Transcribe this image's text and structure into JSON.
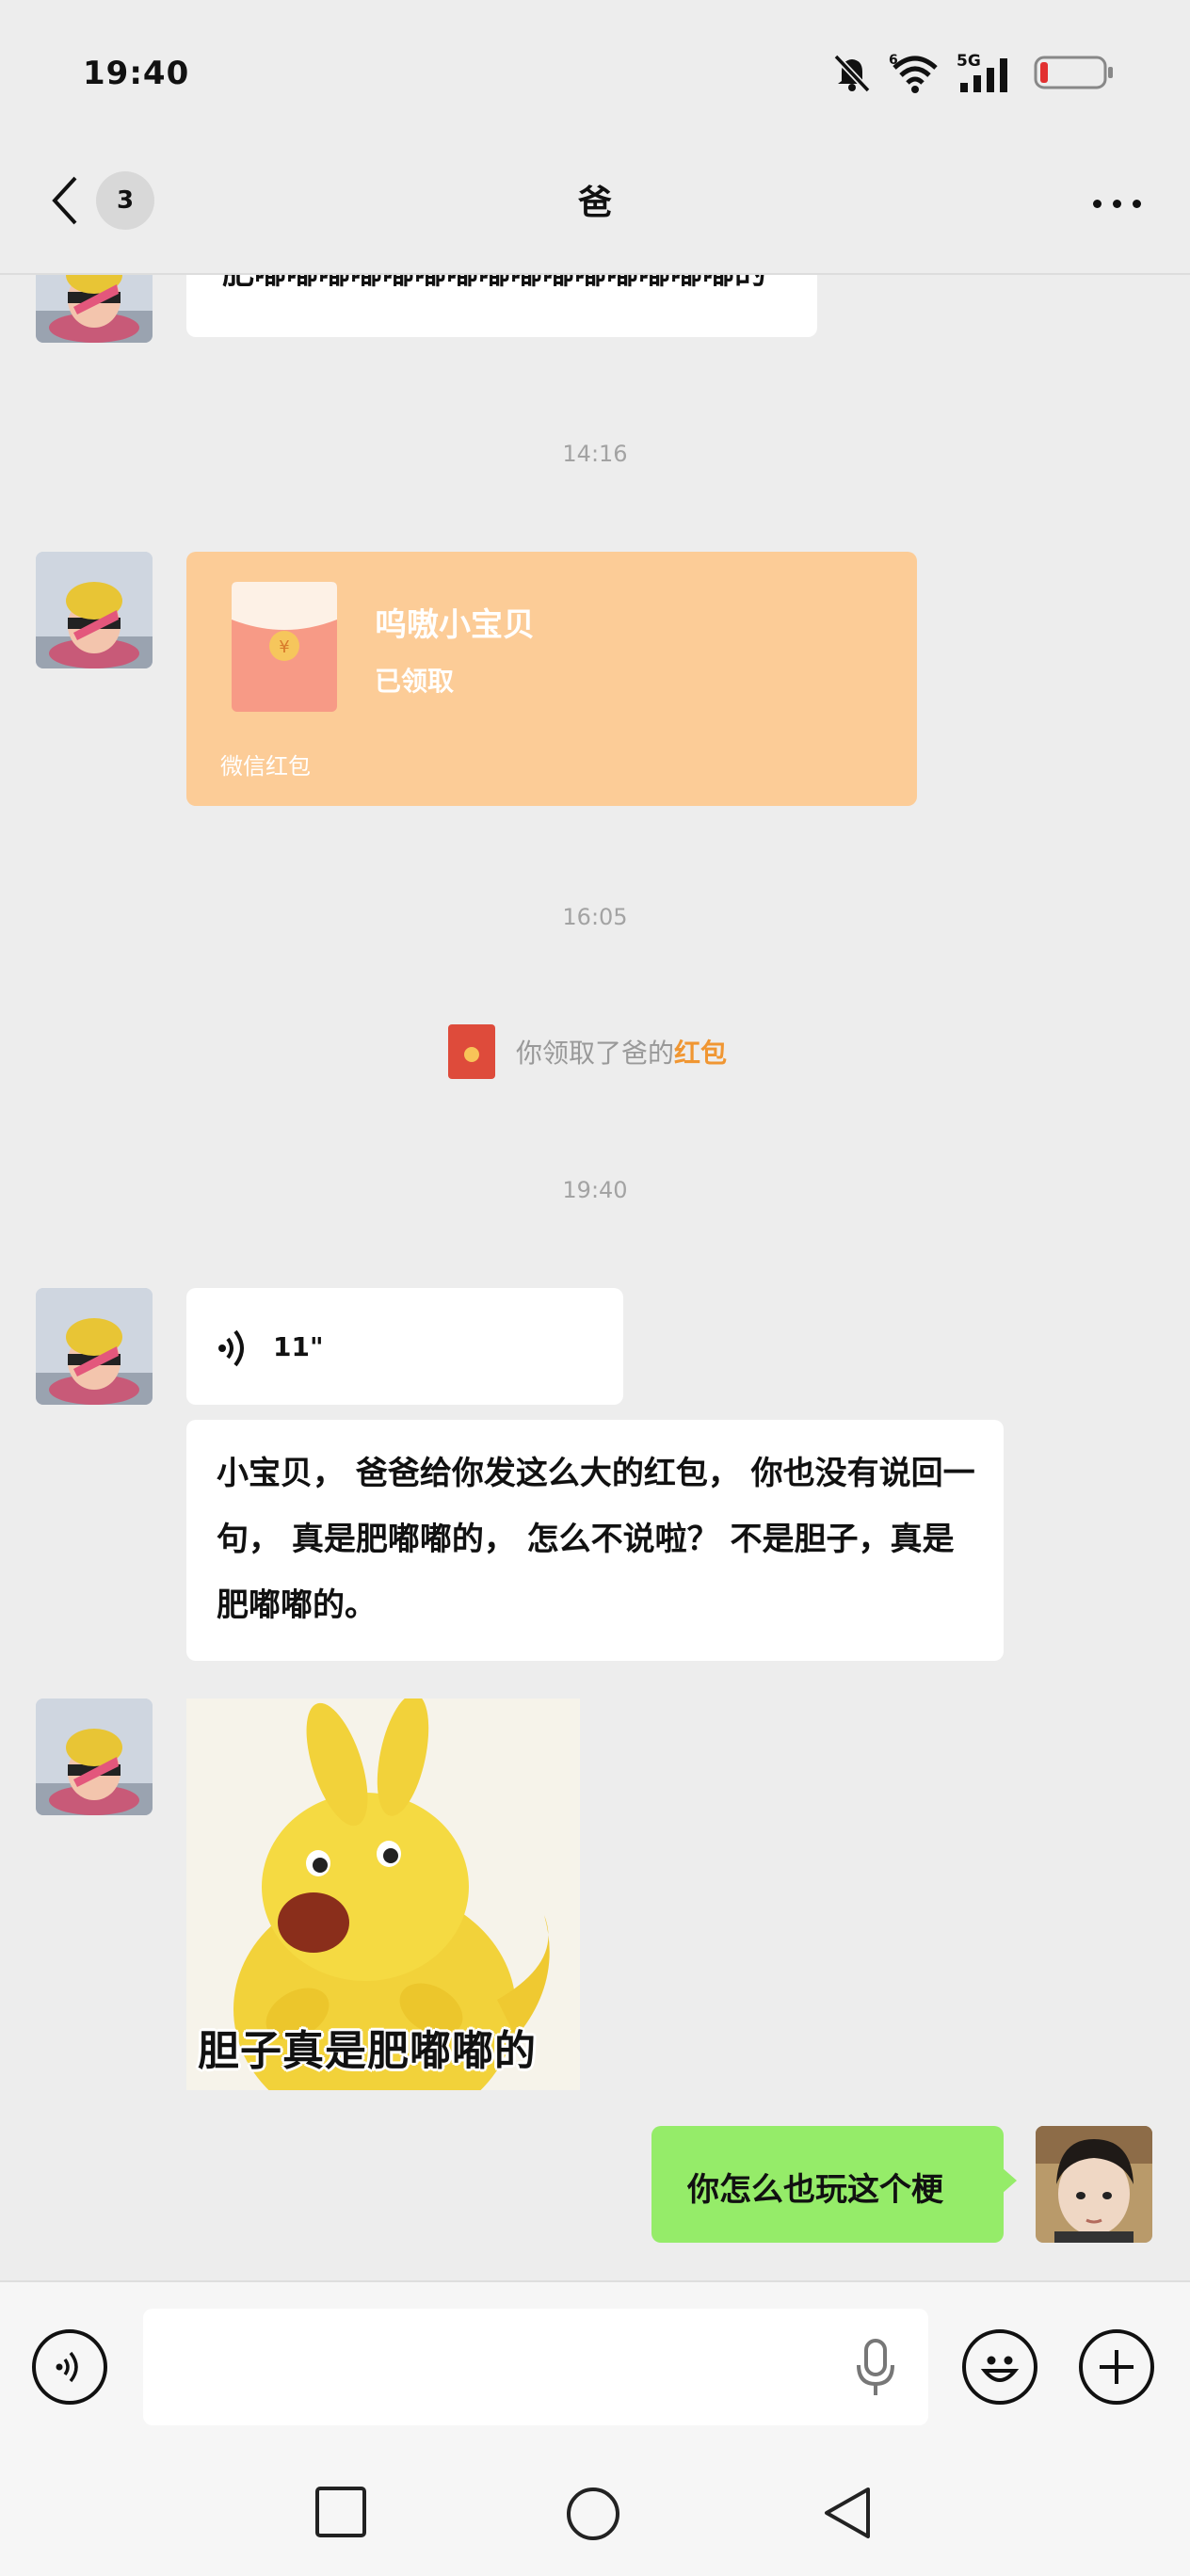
{
  "status_bar": {
    "time": "19:40",
    "signal_label": "5G"
  },
  "nav": {
    "unread_count": "3",
    "title": "爸"
  },
  "messages": {
    "partial_text": "肥嘟嘟嘟嘟嘟嘟嘟嘟嘟嘟嘟嘟嘟嘟嘟的",
    "time_1": "14:16",
    "red_packet": {
      "title": "呜嗷小宝贝",
      "status": "已领取",
      "footer": "微信红包"
    },
    "time_2": "16:05",
    "system_prefix": "你领取了爸的",
    "system_link": "红包",
    "time_3": "19:40",
    "voice_length": "11\"",
    "text_message": "小宝贝， 爸爸给你发这么大的红包， 你也没有说回一句， 真是肥嘟嘟的， 怎么不说啦？ 不是胆子，真是肥嘟嘟的。",
    "sticker_caption": "胆子真是肥嘟嘟的",
    "my_message": "你怎么也玩这个梗"
  },
  "colors": {
    "red_packet_bg": "#fccc97",
    "my_bubble": "#95ec69",
    "link": "#f09632"
  },
  "icons": [
    "back-icon",
    "more-icon",
    "voice-toggle-icon",
    "mic-icon",
    "emoji-icon",
    "plus-icon",
    "home-icon",
    "recents-icon",
    "back-nav-icon"
  ]
}
